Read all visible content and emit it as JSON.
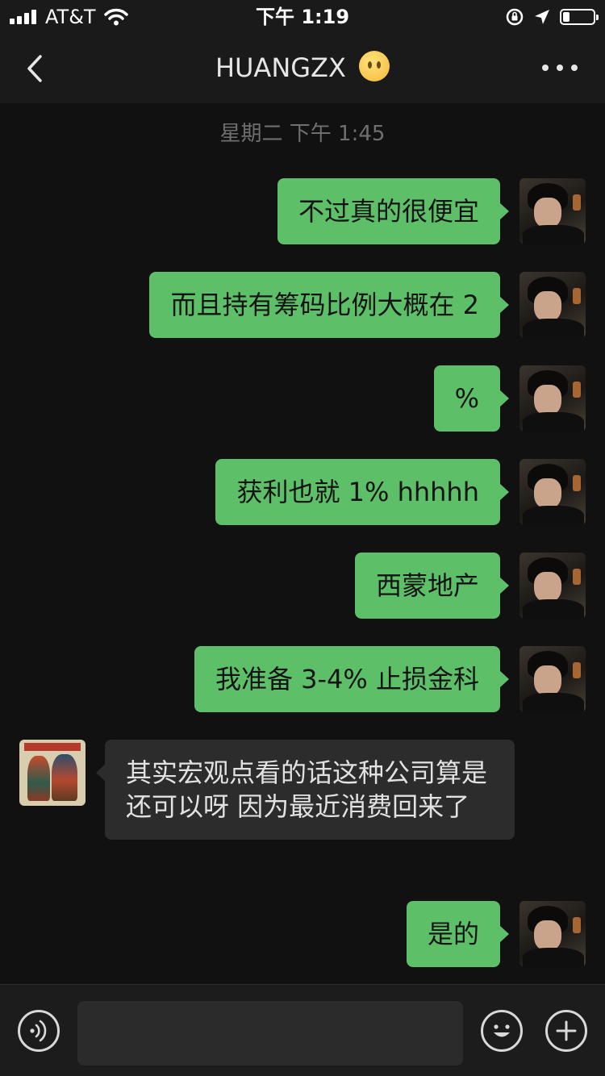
{
  "status_bar": {
    "carrier": "AT&T",
    "time": "下午 1:19"
  },
  "nav": {
    "title": "HUANGZX"
  },
  "chat": {
    "timestamp": "星期二 下午 1:45",
    "messages": [
      {
        "sender": "me",
        "text": "不过真的很便宜"
      },
      {
        "sender": "me",
        "text": "而且持有筹码比例大概在 2"
      },
      {
        "sender": "me",
        "text": "%"
      },
      {
        "sender": "me",
        "text": "获利也就 1% hhhhh"
      },
      {
        "sender": "me",
        "text": "西蒙地产"
      },
      {
        "sender": "me",
        "text": "我准备 3-4% 止损金科"
      },
      {
        "sender": "other",
        "text": " 其实宏观点看的话这种公司算是还可以呀 因为最近消费回来了"
      },
      {
        "sender": "me",
        "text": "是的"
      }
    ]
  },
  "input_bar": {
    "placeholder": ""
  },
  "icons": {
    "status": [
      "signal-icon",
      "wifi-icon",
      "orientation-lock-icon",
      "location-icon",
      "battery-icon"
    ],
    "nav": [
      "back-chevron-icon",
      "smiley-emoji-icon",
      "more-dots-icon"
    ],
    "input": [
      "voice-icon",
      "emoji-icon",
      "plus-icon"
    ]
  },
  "colors": {
    "outgoing_bubble": "#5ebf69",
    "incoming_bubble": "#2c2c2c",
    "background": "#111111"
  }
}
